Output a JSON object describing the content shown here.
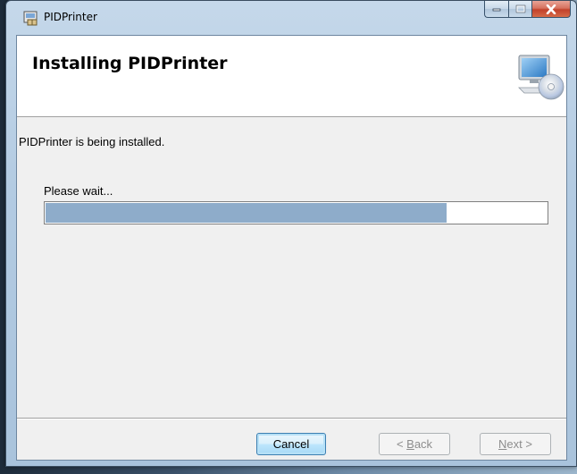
{
  "window": {
    "title": "PIDPrinter"
  },
  "header": {
    "title": "Installing PIDPrinter",
    "icon": "computer-cd-icon"
  },
  "body": {
    "status_text": "PIDPrinter is being installed.",
    "wait_text": "Please wait...",
    "progress_fraction": 0.8
  },
  "buttons": {
    "cancel": "Cancel",
    "back_prefix": "< ",
    "back_accel": "B",
    "back_rest": "ack",
    "next_accel": "N",
    "next_rest": "ext >"
  },
  "colors": {
    "progress_fill": "#8eacca",
    "close_button": "#c2412b"
  }
}
